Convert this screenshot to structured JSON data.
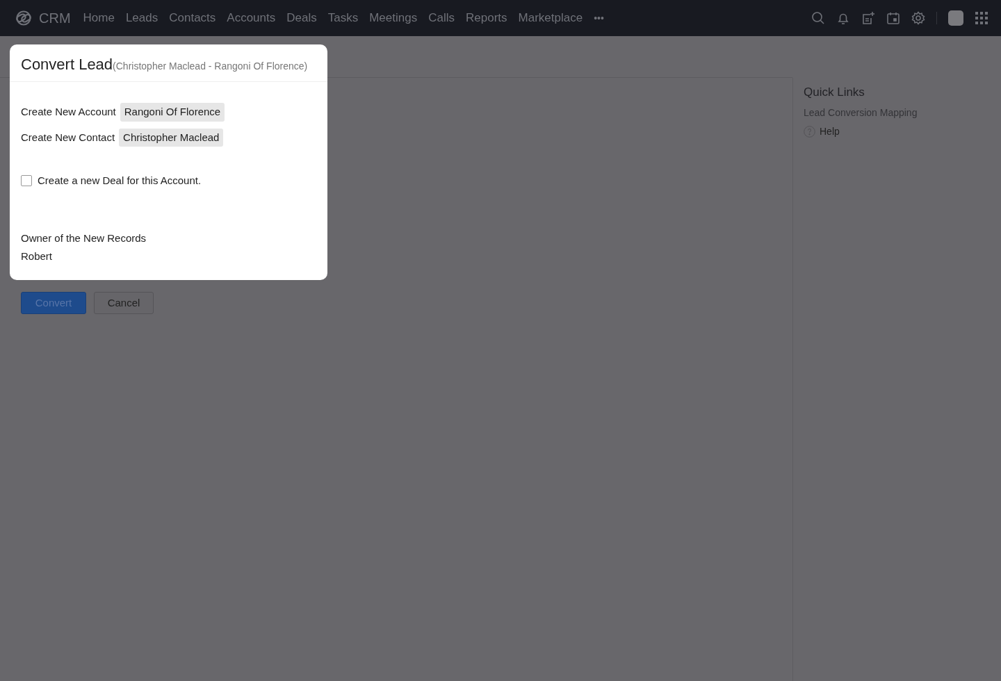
{
  "app": {
    "name": "CRM"
  },
  "nav": [
    {
      "label": "Home"
    },
    {
      "label": "Leads"
    },
    {
      "label": "Contacts"
    },
    {
      "label": "Accounts"
    },
    {
      "label": "Deals"
    },
    {
      "label": "Tasks"
    },
    {
      "label": "Meetings"
    },
    {
      "label": "Calls"
    },
    {
      "label": "Reports"
    },
    {
      "label": "Marketplace"
    }
  ],
  "nav_more": "•••",
  "modal": {
    "title": "Convert Lead",
    "subtitle": "(Christopher Maclead - Rangoni Of Florence)",
    "fields": [
      {
        "label": "Create New Account",
        "value": "Rangoni Of Florence"
      },
      {
        "label": "Create New Contact",
        "value": "Christopher Maclead"
      }
    ],
    "deal_option": {
      "label": "Create a new Deal for this Account.",
      "checked": false
    },
    "owner": {
      "label": "Owner of the New Records",
      "value": "Robert"
    }
  },
  "actions": [
    {
      "label": "Convert",
      "kind": "primary"
    },
    {
      "label": "Cancel",
      "kind": "secondary"
    }
  ],
  "quick_links": {
    "title": "Quick Links",
    "links": [
      {
        "label": "Lead Conversion Mapping",
        "kind": "link"
      },
      {
        "label": "Help",
        "kind": "help"
      }
    ]
  }
}
